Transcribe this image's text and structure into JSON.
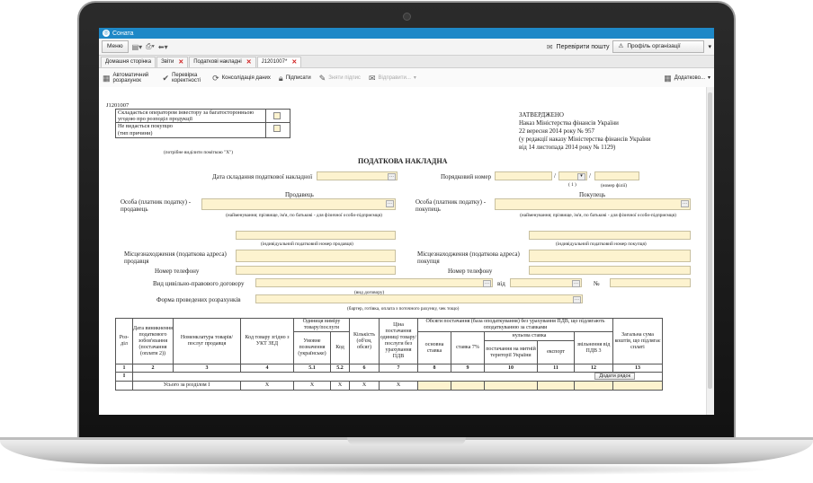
{
  "app": {
    "title": "Соната"
  },
  "menubar": {
    "menu_label": "Меню",
    "check_mail": "Перевірити пошту",
    "org_profile": "Профіль організації"
  },
  "tabs": [
    {
      "label": "Домашня сторінка"
    },
    {
      "label": "Звіти"
    },
    {
      "label": "Податкові накладні"
    },
    {
      "label": "J1201007*"
    }
  ],
  "toolbar": {
    "auto_calc": "Автоматичний розрахунок",
    "check": "Перевірка коректності",
    "consolidate": "Консолідація даних",
    "sign": "Підписати",
    "unsign": "Зняти підпис",
    "send": "Відправити...",
    "more": "Додатково..."
  },
  "form": {
    "code": "J1201007",
    "opt1": "Складається оператором інвестору за багатосторонньою угодою про розподіл продукції",
    "opt2a": "Не видається покупцю",
    "opt2b": "(тип причини)",
    "mark_hint": "(потрібне виділити поміткою \"X\")",
    "approved": "ЗАТВЕРДЖЕНО",
    "order1": "Наказ Міністерства фінансів України",
    "order2": "22 вересня 2014 року № 957",
    "order3": "(у редакції наказу Міністерства фінансів України",
    "order4": "від 14 листопада 2014 року № 1129)",
    "doc_title": "ПОДАТКОВА НАКЛАДНА",
    "date_label": "Дата складання податкової накладної",
    "number_label": "Порядковий номер",
    "slash": "/",
    "note1": "( 1 )",
    "branch": "(номер філії)",
    "seller": "Продавець",
    "buyer": "Покупець",
    "seller_person": "Особа (платник податку) - продавець",
    "buyer_person": "Особа (платник податку) - покупець",
    "name_hint": "(найменування; прізвище, ім'я, по батькові - для фізичної особи-підприємця)",
    "seller_ipn": "(індивідуальний податковий номер продавця)",
    "buyer_ipn": "(індивідуальний податковий номер покупця)",
    "seller_addr": "Місцезнаходження (податкова адреса) продавця",
    "buyer_addr": "Місцезнаходження (податкова адреса) покупця",
    "phone": "Номер телефону",
    "contract": "Вид цивільно-правового договору",
    "from": "від",
    "num_sign": "№",
    "contract_hint": "(вид договору)",
    "payment": "Форма проведених розрахунків",
    "payment_hint": "(бартер, готівка, оплата з поточного рахунку, чек тощо)"
  },
  "table": {
    "h_section": "Роз-діл",
    "h_date": "Дата виникнення податкового зобов'язання (постачання (оплати 2))",
    "h_name": "Номенклатура товарів/послуг продавця",
    "h_code": "Код товару згідно з УКТ ЗЕД",
    "h_unit": "Одиниця виміру товару/послуги",
    "h_unit_a": "Умовне позначення (українське)",
    "h_unit_b": "Код",
    "h_qty": "Кількість (об'єм, обсяг)",
    "h_price": "Ціна постачання одиниці товару/послуги без урахування ПДВ",
    "h_volume": "Обсяги постачання (база оподаткування) без урахування ПДВ, що підлягають оподаткуванню за ставками",
    "h_basic": "основна ставка",
    "h_rate7": "ставка 7%",
    "h_zero": "нульова ставка",
    "h_zero_a": "постачання на митній території України",
    "h_zero_b": "експорт",
    "h_exempt": "звільнення від ПДВ 3",
    "h_total": "Загальна сума коштів, що підлягає сплаті",
    "nums": [
      "1",
      "2",
      "3",
      "4",
      "5.1",
      "5.2",
      "6",
      "7",
      "8",
      "9",
      "10",
      "11",
      "12",
      "13"
    ],
    "section_I": "I",
    "add_row": "Додати рядок",
    "total_row": "Усього за розділом І",
    "x": "X"
  }
}
